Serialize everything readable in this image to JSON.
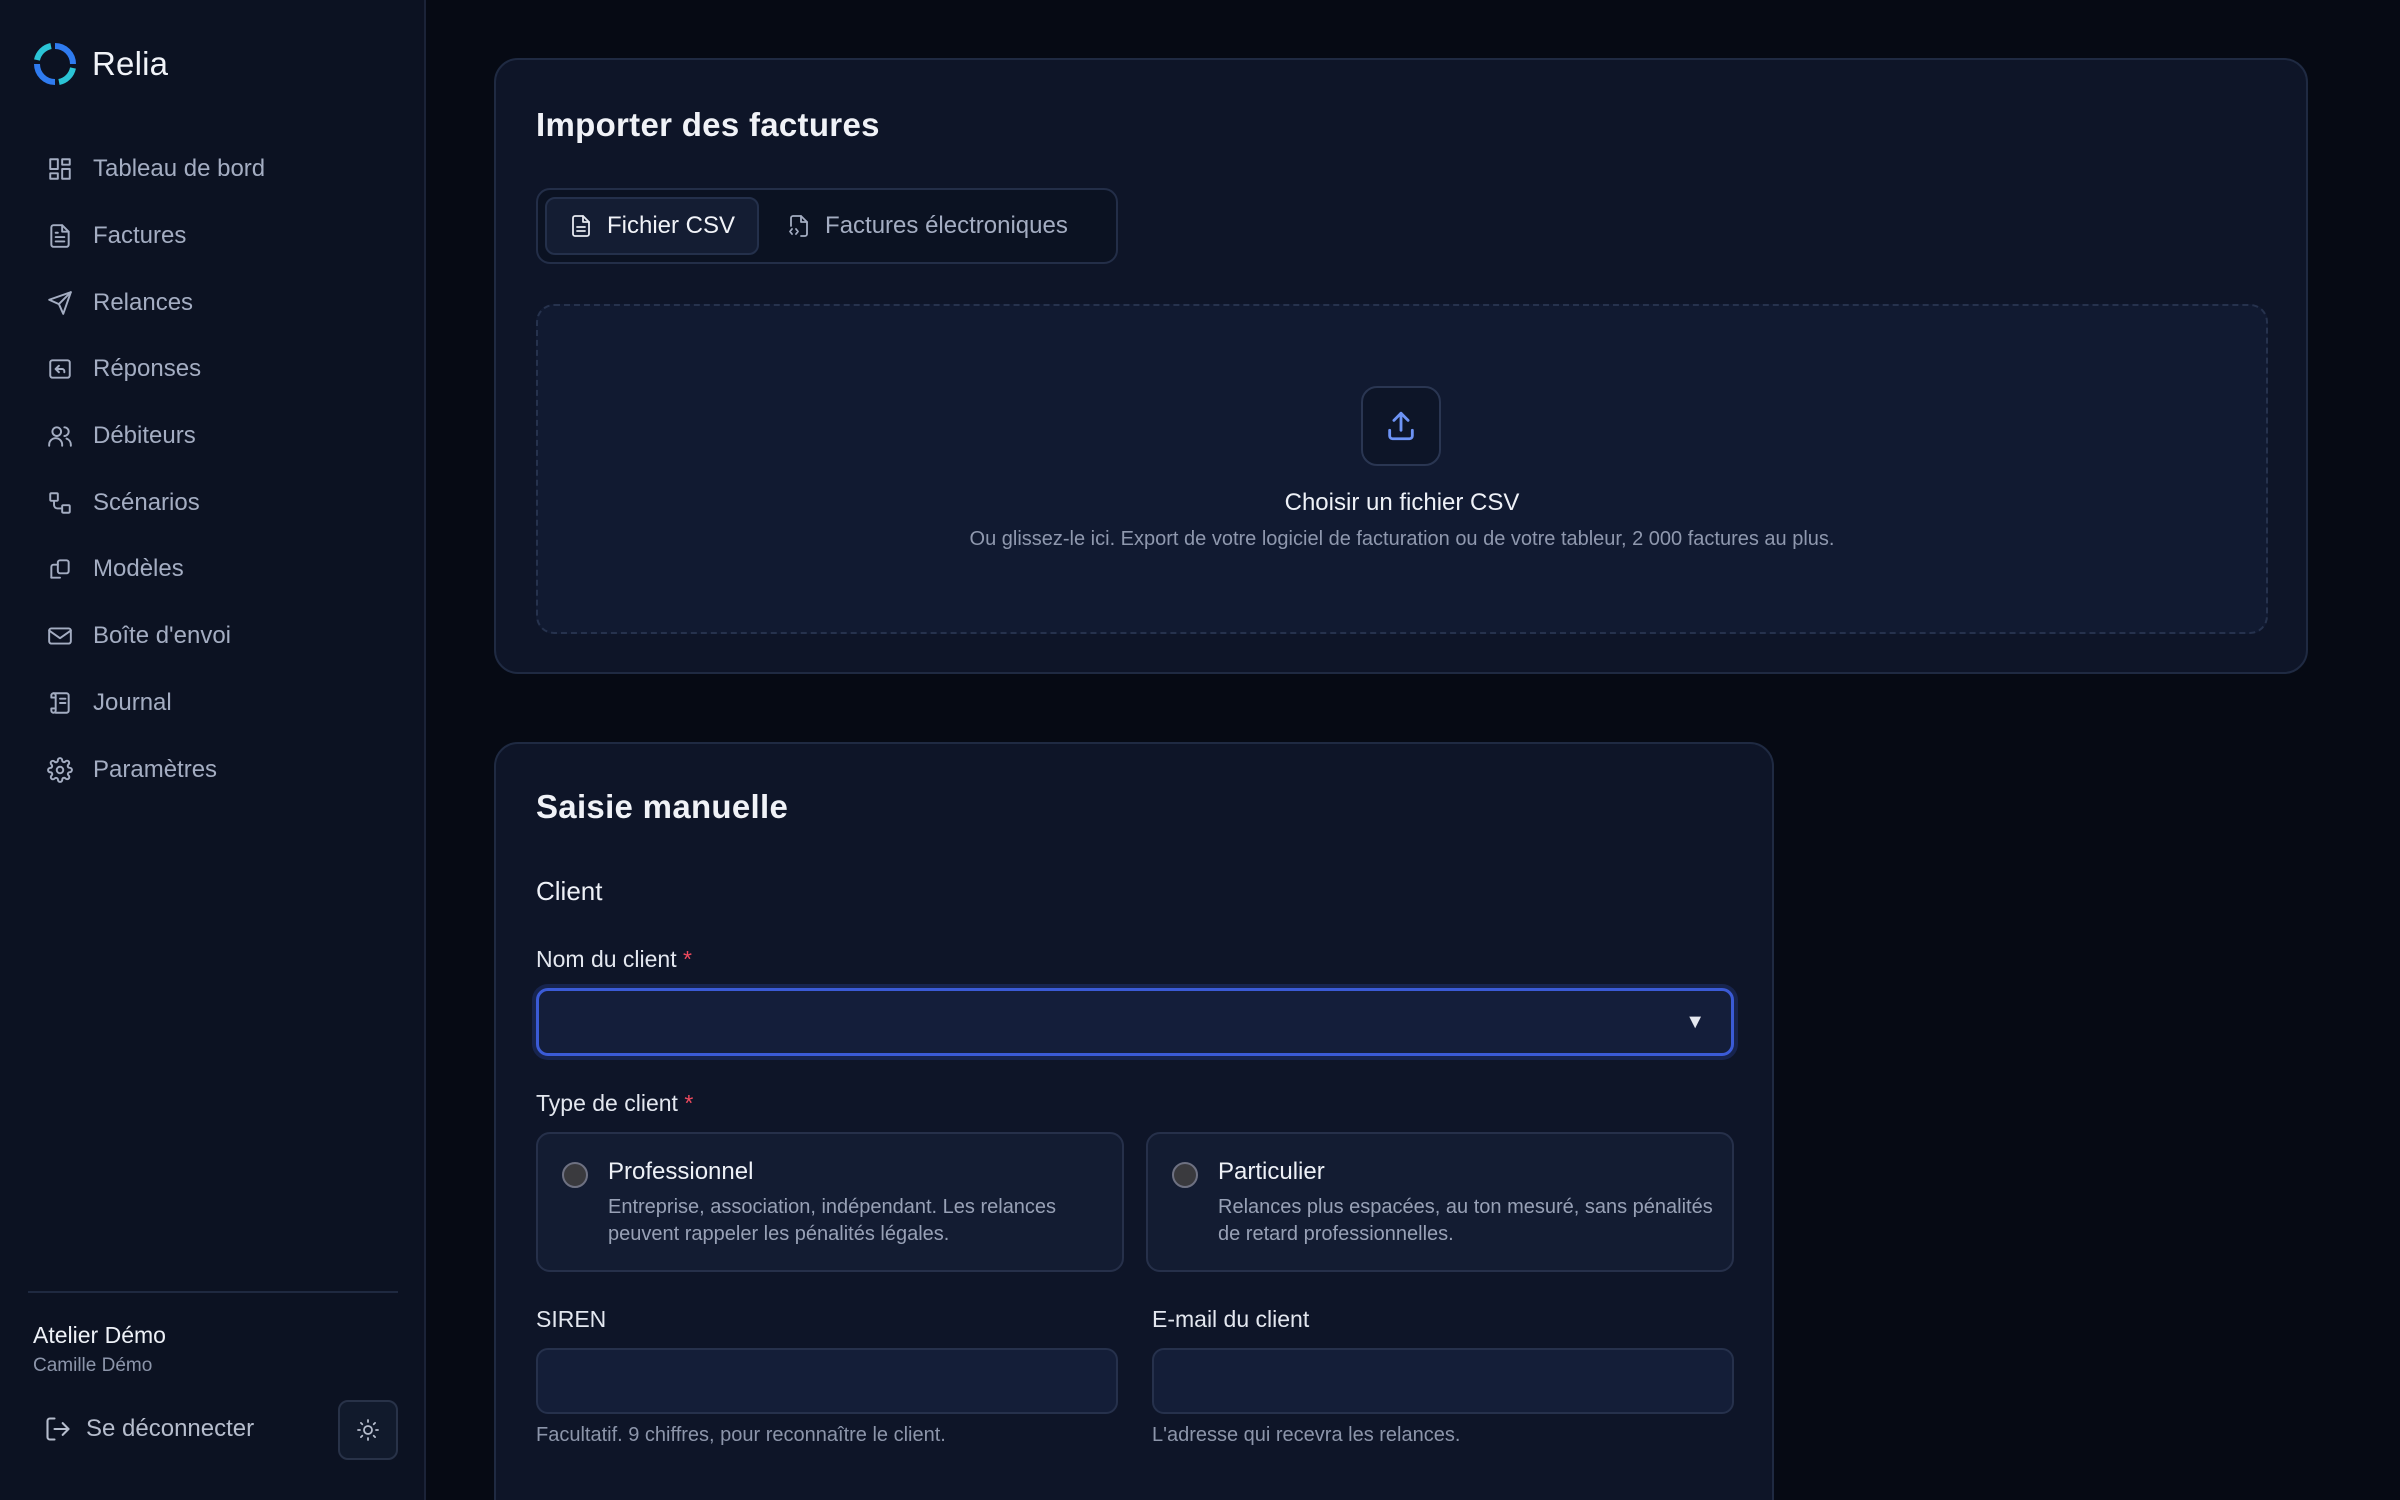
{
  "app": {
    "name": "Relia"
  },
  "colors": {
    "accent": "#3b5bd6",
    "required": "#ef4a5e",
    "logo_blue": "#2f7bf0",
    "logo_cyan": "#2bc4d6"
  },
  "sidebar": {
    "items": [
      {
        "label": "Tableau de bord",
        "icon": "dashboard-icon"
      },
      {
        "label": "Factures",
        "icon": "file-text-icon"
      },
      {
        "label": "Relances",
        "icon": "send-icon"
      },
      {
        "label": "Réponses",
        "icon": "reply-icon"
      },
      {
        "label": "Débiteurs",
        "icon": "users-icon"
      },
      {
        "label": "Scénarios",
        "icon": "workflow-icon"
      },
      {
        "label": "Modèles",
        "icon": "templates-icon"
      },
      {
        "label": "Boîte d'envoi",
        "icon": "mail-icon"
      },
      {
        "label": "Journal",
        "icon": "scroll-icon"
      },
      {
        "label": "Paramètres",
        "icon": "gear-icon"
      }
    ],
    "org_name": "Atelier Démo",
    "user_name": "Camille Démo",
    "logout_label": "Se déconnecter"
  },
  "import": {
    "title": "Importer des factures",
    "tabs": [
      {
        "label": "Fichier CSV",
        "active": true
      },
      {
        "label": "Factures électroniques",
        "active": false
      }
    ],
    "dropzone": {
      "title": "Choisir un fichier CSV",
      "subtitle": "Ou glissez-le ici. Export de votre logiciel de facturation ou de votre tableur, 2 000 factures au plus."
    }
  },
  "manual": {
    "title": "Saisie manuelle",
    "section": "Client",
    "client_name": {
      "label": "Nom du client",
      "required": "*",
      "value": ""
    },
    "client_type": {
      "label": "Type de client",
      "required": "*",
      "options": [
        {
          "title": "Professionnel",
          "desc": "Entreprise, association, indépendant. Les relances peuvent rappeler les pénalités légales."
        },
        {
          "title": "Particulier",
          "desc": "Relances plus espacées, au ton mesuré, sans pénalités de retard professionnelles."
        }
      ]
    },
    "siren": {
      "label": "SIREN",
      "hint": "Facultatif. 9 chiffres, pour reconnaître le client."
    },
    "email": {
      "label": "E-mail du client",
      "hint": "L'adresse qui recevra les relances."
    }
  }
}
